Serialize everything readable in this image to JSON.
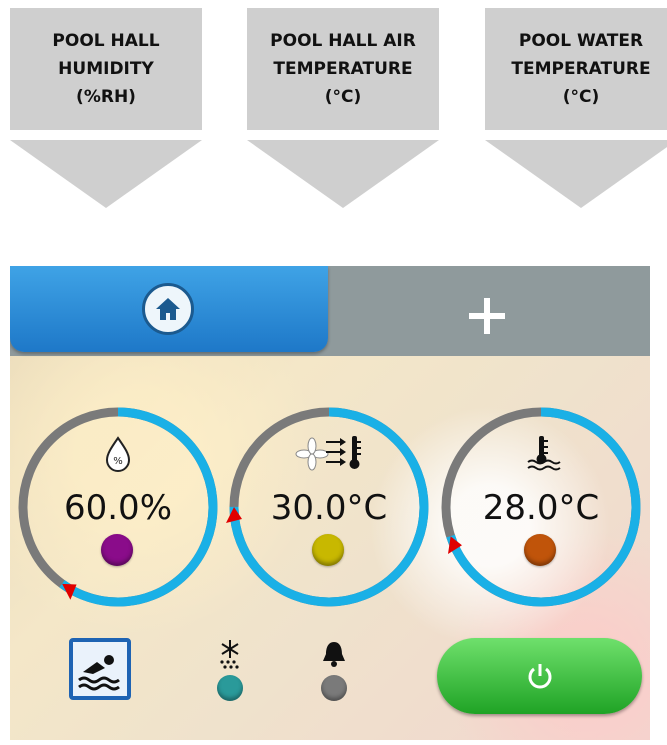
{
  "callouts": [
    {
      "label": "POOL HALL\nHUMIDITY\n(%RH)"
    },
    {
      "label": "POOL HALL AIR\nTEMPERATURE\n(°C)"
    },
    {
      "label": "POOL WATER\nTEMPERATURE\n(°C)"
    }
  ],
  "topbar": {
    "home_icon": "home-icon",
    "plus_icon": "plus-icon"
  },
  "gauges": [
    {
      "name": "humidity",
      "icon": "humidity-drop-icon",
      "value": "60.0%",
      "indicator_color": "#8a0c8a",
      "fill_fraction": 0.6
    },
    {
      "name": "air-temperature",
      "icon": "fan-thermometer-icon",
      "value": "30.0°C",
      "indicator_color": "#c8b800",
      "fill_fraction": 0.75
    },
    {
      "name": "water-temperature",
      "icon": "water-thermometer-icon",
      "value": "28.0°C",
      "indicator_color": "#c0540a",
      "fill_fraction": 0.7
    }
  ],
  "bottom": {
    "swim_icon": "swimmer-icon",
    "indicators": [
      {
        "icon": "snowflake-icon",
        "color": "#2a9a9a"
      },
      {
        "icon": "bell-icon",
        "color": "#7a7a7a"
      }
    ],
    "power_icon": "power-icon"
  },
  "colors": {
    "accent_blue": "#1e78c8",
    "gauge_ring": "#1ab0e6",
    "gauge_track": "#7a7a7a",
    "power_green": "#3cc23c",
    "marker_red": "#e00000"
  }
}
